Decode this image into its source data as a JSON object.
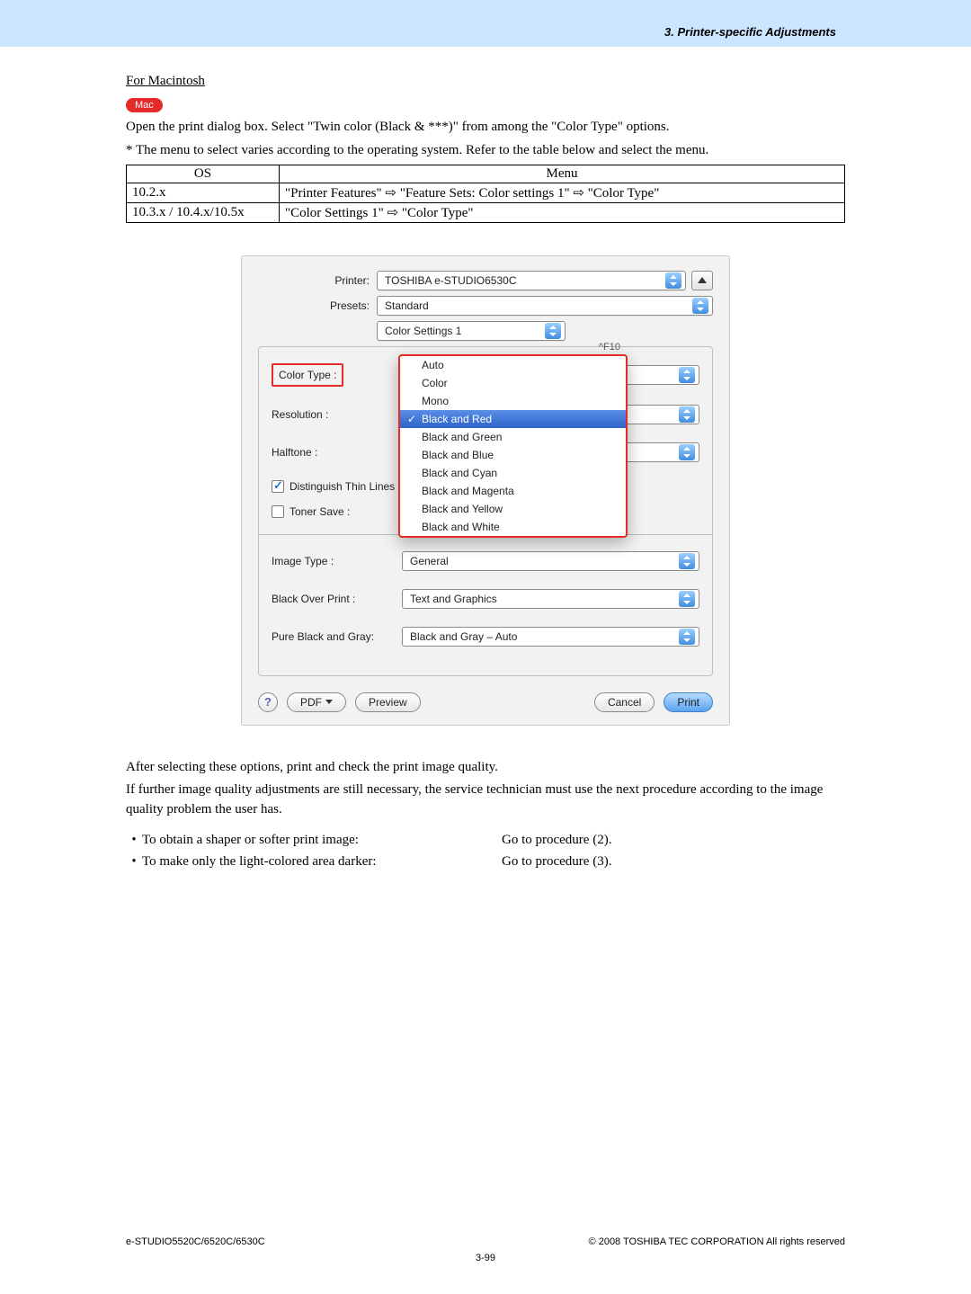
{
  "header": {
    "section": "3. Printer-specific Adjustments"
  },
  "section_title": "For Macintosh",
  "mac_badge": "Mac",
  "intro": "Open the print dialog box.  Select \"Twin color (Black & ***)\" from among the \"Color Type\" options.",
  "note": "* The menu to select varies according to the operating system.  Refer to the table below and select the menu.",
  "os_table": {
    "head_os": "OS",
    "head_menu": "Menu",
    "rows": [
      {
        "os": "10.2.x",
        "menu": "\"Printer Features\" ⇨ \"Feature Sets: Color settings 1\" ⇨ \"Color Type\""
      },
      {
        "os": "10.3.x / 10.4.x/10.5x",
        "menu": "\"Color Settings 1\" ⇨ \"Color Type\""
      }
    ]
  },
  "dialog": {
    "printer_label": "Printer:",
    "printer_value": "TOSHIBA e-STUDIO6530C",
    "presets_label": "Presets:",
    "presets_value": "Standard",
    "group_tab": "Color Settings 1",
    "fields": {
      "color_type": "Color Type :",
      "resolution": "Resolution :",
      "halftone": "Halftone :",
      "distinguish": "Distinguish Thin Lines :",
      "toner_save": "Toner Save :",
      "image_type": "Image Type :",
      "image_type_val": "General",
      "black_over_print": "Black Over Print :",
      "black_over_print_val": "Text and Graphics",
      "pure_black_gray": "Pure Black and Gray:",
      "pure_black_gray_val": "Black and Gray – Auto"
    },
    "menu": {
      "shortcut": "^F10",
      "items": [
        "Auto",
        "Color",
        "Mono",
        "Black and Red",
        "Black and Green",
        "Black and Blue",
        "Black and Cyan",
        "Black and Magenta",
        "Black and Yellow",
        "Black and White"
      ],
      "selected_index": 3
    },
    "buttons": {
      "help": "?",
      "pdf": "PDF",
      "preview": "Preview",
      "cancel": "Cancel",
      "print": "Print"
    }
  },
  "after": {
    "p1": "After selecting these options, print and check the print image quality.",
    "p2": "If further image quality adjustments are still necessary, the service technician must use the next procedure according to the image quality problem the user has.",
    "procs": [
      {
        "left": "To obtain a shaper or softer print image:",
        "right": "Go to procedure (2)."
      },
      {
        "left": "To make only the light-colored area darker:",
        "right": "Go to procedure (3)."
      }
    ]
  },
  "footer": {
    "left": "e-STUDIO5520C/6520C/6530C",
    "right": "© 2008 TOSHIBA TEC CORPORATION All rights reserved",
    "page": "3-99"
  }
}
